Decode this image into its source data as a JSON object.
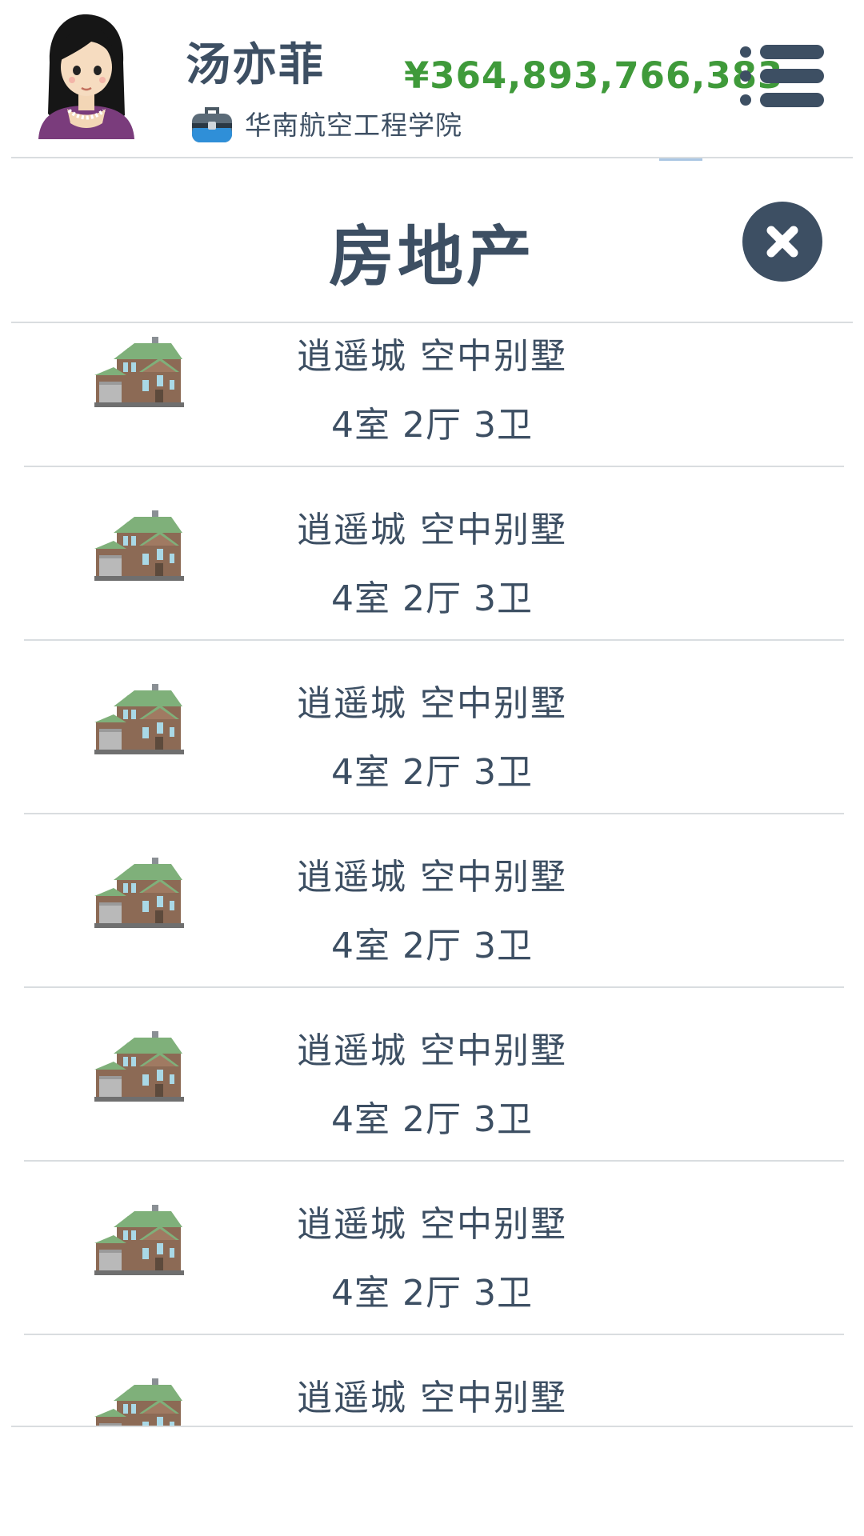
{
  "header": {
    "player_name": "汤亦菲",
    "school": "华南航空工程学院",
    "money": "¥364,893,766,383",
    "avatar_icon": "female-avatar",
    "school_icon": "briefcase-icon",
    "menu_icon": "list-menu-icon"
  },
  "page": {
    "title": "房地产",
    "close_icon": "close-icon"
  },
  "properties": [
    {
      "name": "逍遥城 空中别墅",
      "rooms": "4室 2厅 3卫",
      "icon": "house-icon"
    },
    {
      "name": "逍遥城 空中别墅",
      "rooms": "4室 2厅 3卫",
      "icon": "house-icon"
    },
    {
      "name": "逍遥城 空中别墅",
      "rooms": "4室 2厅 3卫",
      "icon": "house-icon"
    },
    {
      "name": "逍遥城 空中别墅",
      "rooms": "4室 2厅 3卫",
      "icon": "house-icon"
    },
    {
      "name": "逍遥城 空中别墅",
      "rooms": "4室 2厅 3卫",
      "icon": "house-icon"
    },
    {
      "name": "逍遥城 空中别墅",
      "rooms": "4室 2厅 3卫",
      "icon": "house-icon"
    },
    {
      "name": "逍遥城 空中别墅",
      "rooms": "",
      "icon": "house-icon"
    }
  ],
  "colors": {
    "text": "#3d4f63",
    "money": "#3f9a3a",
    "divider": "#d9dde0"
  }
}
